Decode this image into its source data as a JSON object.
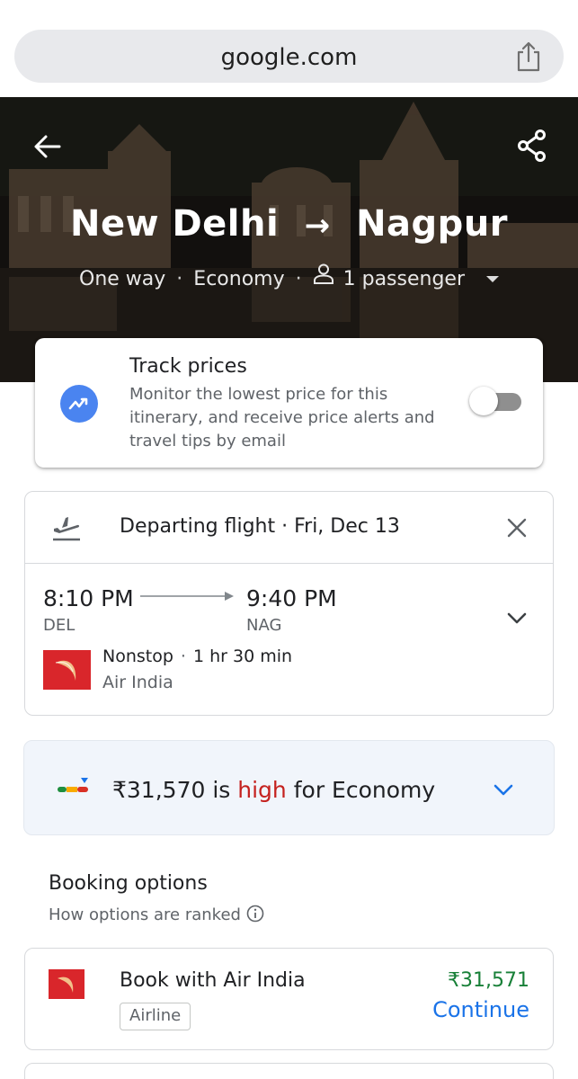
{
  "browser": {
    "url": "google.com",
    "share_icon": "share-upload-icon"
  },
  "hero": {
    "origin": "New Delhi",
    "arrow": "→",
    "destination": "Nagpur",
    "trip_type": "One way",
    "cabin_class": "Economy",
    "passengers": "1 passenger",
    "back_icon": "arrow-left-icon",
    "share_icon": "share-icon"
  },
  "track_prices": {
    "title": "Track prices",
    "description": "Monitor the lowest price for this itinerary, and receive price alerts and travel tips by email",
    "enabled": false,
    "accent": "#4a84f0"
  },
  "flight": {
    "header": "Departing flight · Fri, Dec 13",
    "departure_time": "8:10 PM",
    "arrival_time": "9:40 PM",
    "departure_code": "DEL",
    "arrival_code": "NAG",
    "stops": "Nonstop",
    "duration": "1 hr 30 min",
    "airline": "Air India",
    "logo_color": "#d9262b"
  },
  "price_insight": {
    "price": "₹31,570",
    "is_word": " is ",
    "level": "high",
    "suffix": " for Economy",
    "level_color": "#c5221f"
  },
  "booking": {
    "title": "Booking options",
    "subtitle": "How options are ranked",
    "option": {
      "title": "Book with Air India",
      "tag": "Airline",
      "price": "₹31,571",
      "action": "Continue",
      "price_color": "#188038",
      "action_color": "#1a73e8"
    }
  }
}
